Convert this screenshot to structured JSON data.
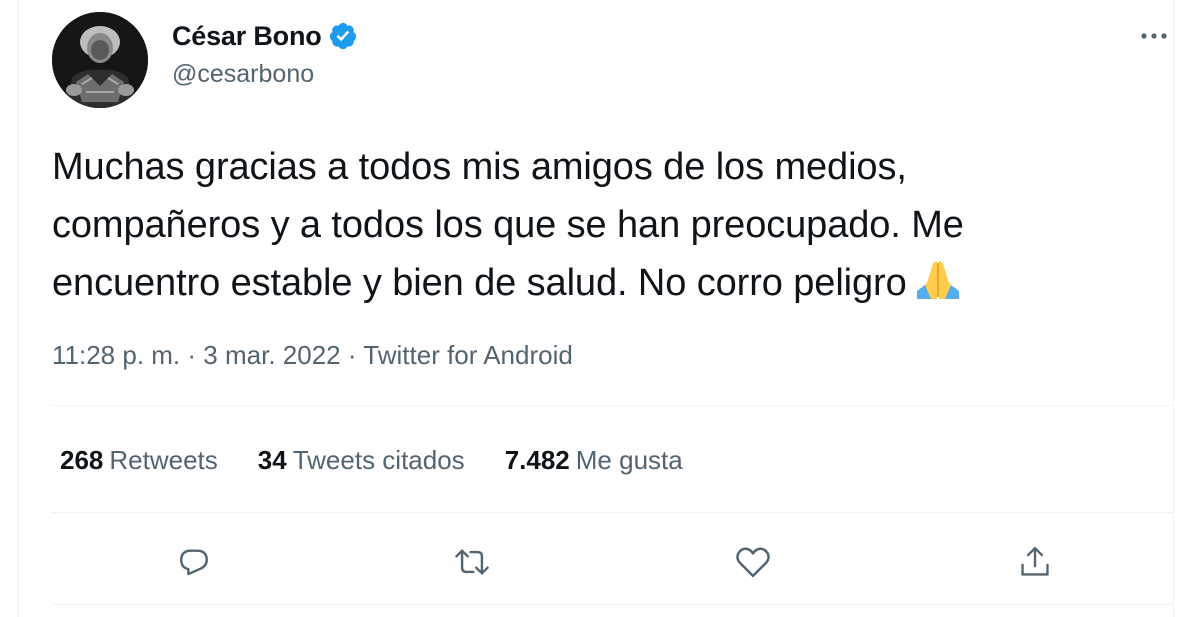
{
  "author": {
    "display_name": "César Bono",
    "handle": "@cesarbono",
    "verified": true,
    "avatar_icon": "profile-photo"
  },
  "tweet": {
    "text_lines": [
      "Muchas gracias a todos mis amigos de los medios,",
      "compañeros y a todos los que se han preocupado. Me",
      "encuentro estable y bien de salud. No corro peligro"
    ],
    "emoji": "folded-hands",
    "time": "11:28 p. m.",
    "separator": "·",
    "date": "3 mar. 2022",
    "source": "Twitter for Android"
  },
  "stats": {
    "retweets": {
      "count": "268",
      "label": "Retweets"
    },
    "quotes": {
      "count": "34",
      "label": "Tweets citados"
    },
    "likes": {
      "count": "7.482",
      "label": "Me gusta"
    }
  },
  "actions": [
    "reply-icon",
    "retweet-icon",
    "like-icon",
    "share-icon"
  ],
  "colors": {
    "text": "#0f1419",
    "secondary": "#536471",
    "verified": "#1d9bf0",
    "divider": "#eff3f4"
  }
}
